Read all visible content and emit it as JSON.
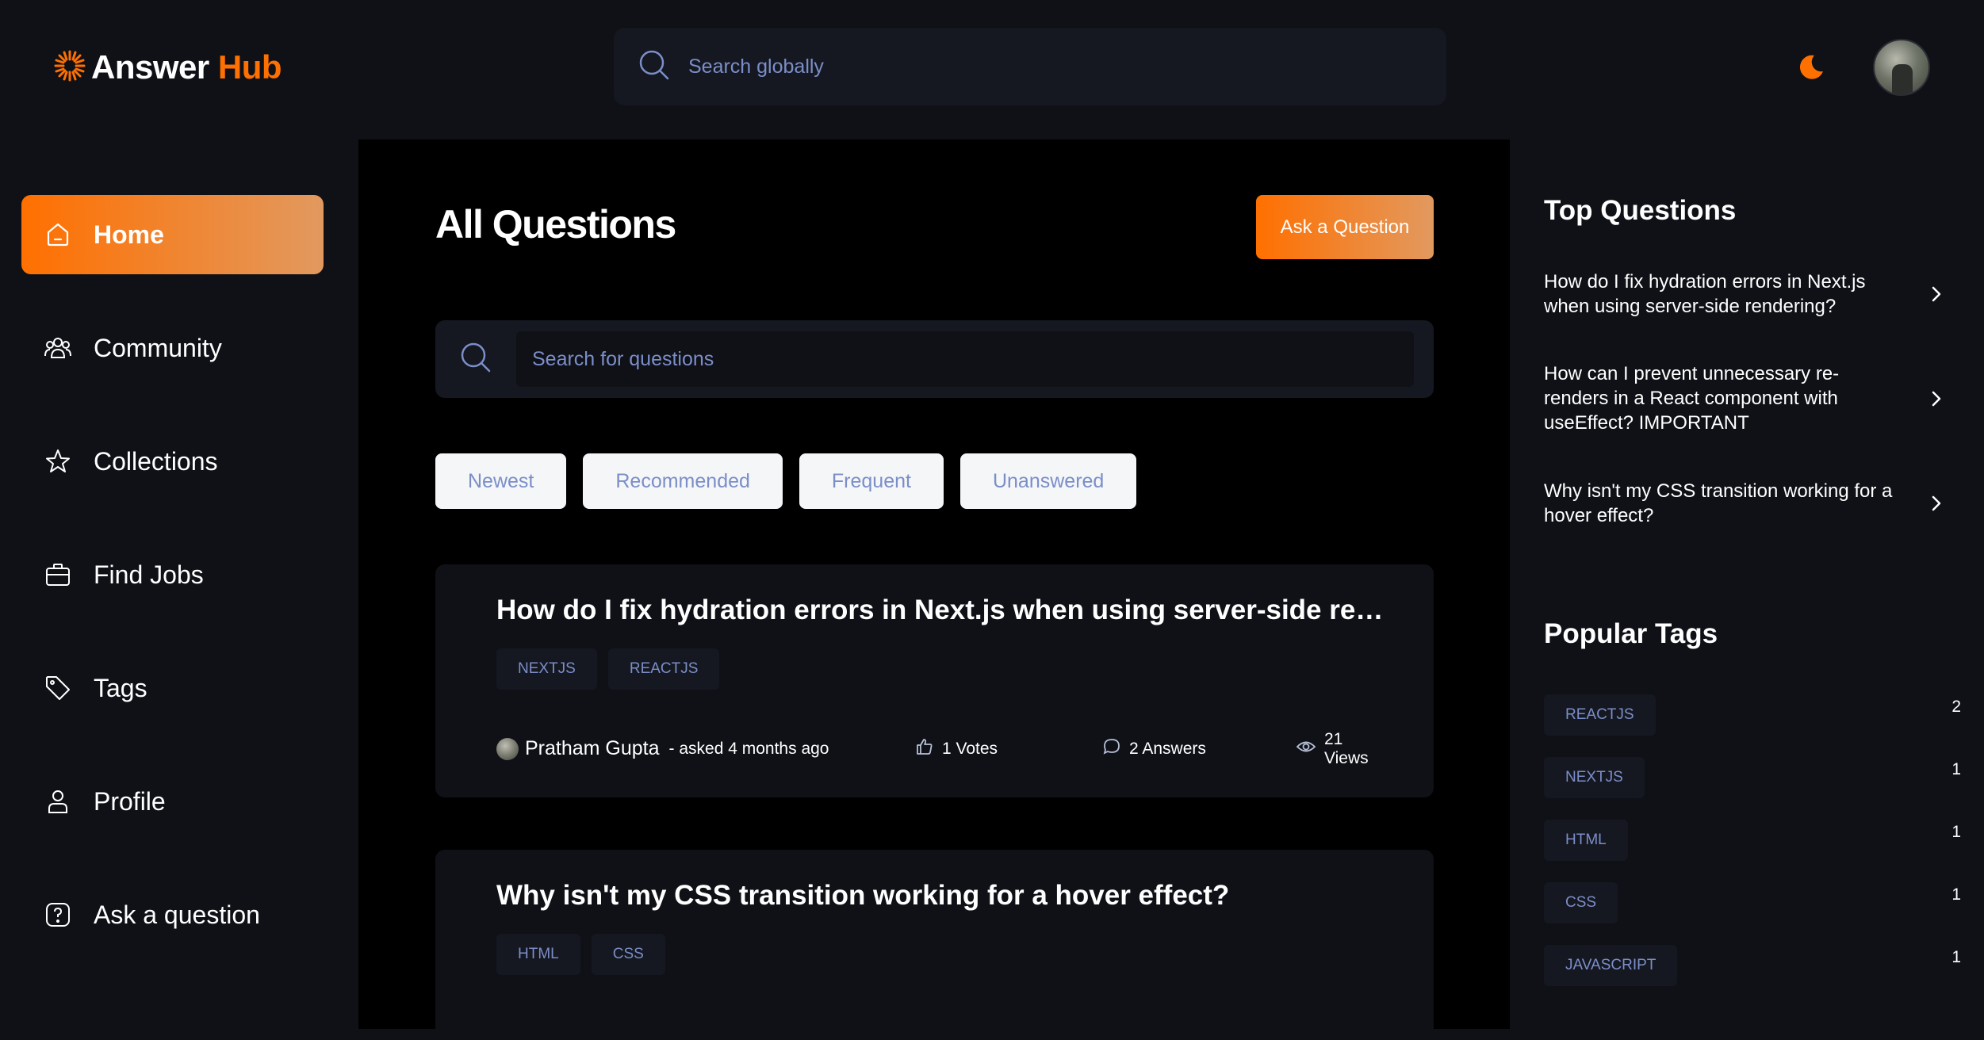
{
  "brand": {
    "name_part1": "Answer",
    "name_part2": "Hub",
    "accent": "#ff7000"
  },
  "header": {
    "search_placeholder": "Search globally",
    "theme_icon": "moon-icon"
  },
  "sidebar": {
    "items": [
      {
        "label": "Home",
        "icon": "home-icon",
        "active": true
      },
      {
        "label": "Community",
        "icon": "users-icon"
      },
      {
        "label": "Collections",
        "icon": "star-icon"
      },
      {
        "label": "Find Jobs",
        "icon": "briefcase-icon"
      },
      {
        "label": "Tags",
        "icon": "tag-icon"
      },
      {
        "label": "Profile",
        "icon": "user-icon"
      },
      {
        "label": "Ask a question",
        "icon": "question-icon"
      }
    ]
  },
  "main": {
    "title": "All Questions",
    "ask_button": "Ask a Question",
    "search_placeholder": "Search for questions",
    "filters": [
      "Newest",
      "Recommended",
      "Frequent",
      "Unanswered"
    ],
    "questions": [
      {
        "title": "How do I fix hydration errors in Next.js when using server-side rendering?",
        "tags": [
          "NEXTJS",
          "REACTJS"
        ],
        "author": "Pratham Gupta",
        "asked": "- asked 4 months ago",
        "votes": "1 Votes",
        "answers": "2 Answers",
        "views": "21 Views"
      },
      {
        "title": "Why isn't my CSS transition working for a hover effect?",
        "tags": [
          "HTML",
          "CSS"
        ]
      }
    ]
  },
  "rightbar": {
    "top_title": "Top Questions",
    "top_questions": [
      "How do I fix hydration errors in Next.js when using server-side rendering?",
      "How can I prevent unnecessary re-renders in a React component with useEffect? IMPORTANT",
      "Why isn't my CSS transition working for a hover effect?"
    ],
    "tags_title": "Popular Tags",
    "popular_tags": [
      {
        "name": "REACTJS",
        "count": "2"
      },
      {
        "name": "NEXTJS",
        "count": "1"
      },
      {
        "name": "HTML",
        "count": "1"
      },
      {
        "name": "CSS",
        "count": "1"
      },
      {
        "name": "JAVASCRIPT",
        "count": "1"
      }
    ]
  }
}
